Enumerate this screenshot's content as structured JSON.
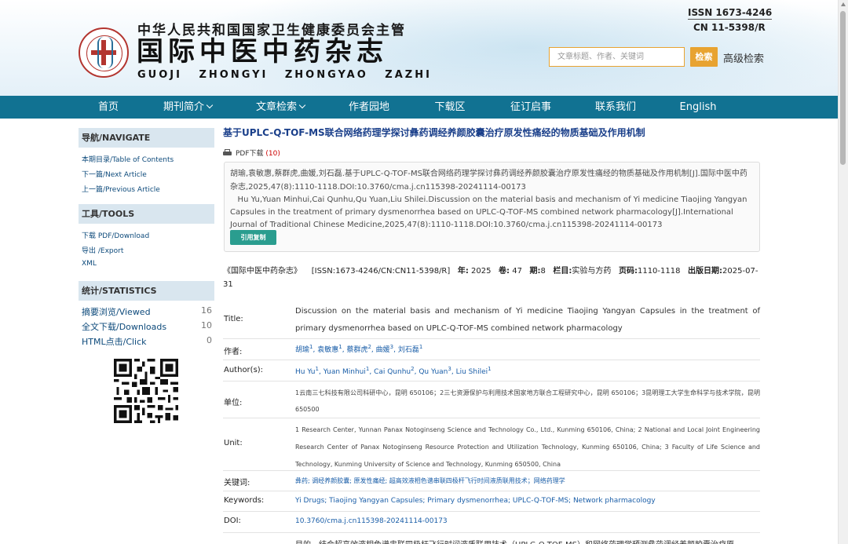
{
  "header": {
    "sponsor": "中华人民共和国国家卫生健康委员会主管",
    "journal_cn": "国际中医中药杂志",
    "journal_pinyin": "GUOJI ZHONGYI ZHONGYAO ZAZHI",
    "issn": "ISSN 1673-4246",
    "cn": "CN 11-5398/R",
    "search_placeholder": "文章标题、作者、关键词",
    "search_button": "检索",
    "advanced_search": "高级检索"
  },
  "nav": [
    {
      "label": "首页",
      "dropdown": false
    },
    {
      "label": "期刊简介",
      "dropdown": true
    },
    {
      "label": "文章检索",
      "dropdown": true
    },
    {
      "label": "作者园地",
      "dropdown": false
    },
    {
      "label": "下载区",
      "dropdown": false
    },
    {
      "label": "征订启事",
      "dropdown": false
    },
    {
      "label": "联系我们",
      "dropdown": false
    },
    {
      "label": "English",
      "dropdown": false
    }
  ],
  "sidebar": {
    "navigate_title": "导航/NAVIGATE",
    "navigate_links": [
      "本期目录/Table of Contents",
      "下一篇/Next Article",
      "上一篇/Previous Article"
    ],
    "tools_title": "工具/TOOLS",
    "tools_links": [
      "下载 PDF/Download",
      "导出 /Export",
      "XML"
    ],
    "stats_title": "统计/STATISTICS",
    "stats": [
      {
        "label": "摘要浏览/Viewed",
        "value": "16"
      },
      {
        "label": "全文下载/Downloads",
        "value": "10"
      },
      {
        "label": "HTML点击/Click",
        "value": "0"
      }
    ]
  },
  "article": {
    "title": "基于UPLC-Q-TOF-MS联合网络药理学探讨彝药调经养颜胶囊治疗原发性痛经的物质基础及作用机制",
    "pdf_label": "PDF下载",
    "pdf_count": "(10)",
    "citation_cn": "胡瑜,袁敏惠,蔡群虎,曲媛,刘石磊.基于UPLC-Q-TOF-MS联合网络药理学探讨彝药调经养颜胶囊治疗原发性痛经的物质基础及作用机制[J].国际中医中药杂志,2025,47(8):1110-1118.DOI:10.3760/cma.j.cn115398-20241114-00173",
    "citation_en": "Hu Yu,Yuan Minhui,Cai Qunhu,Qu Yuan,Liu Shilei.Discussion on the material basis and mechanism of Yi medicine Tiaojing Yangyan Capsules in the treatment of primary dysmenorrhea based on UPLC-Q-TOF-MS combined network pharmacology[J].International Journal of Traditional Chinese Medicine,2025,47(8):1110-1118.DOI:10.3760/cma.j.cn115398-20241114-00173",
    "cite_button": "引用复制",
    "meta": {
      "journal": "《国际中医中药杂志》",
      "issn": "[ISSN:1673-4246/CN:CN11-5398/R]",
      "year_label": "年:",
      "year": "2025",
      "volume_label": "卷:",
      "volume": "47",
      "issue_label": "期:",
      "issue": "8",
      "column_label": "栏目:",
      "column": "实验与方药",
      "pages_label": "页码:",
      "pages": "1110-1118",
      "date_label": "出版日期:",
      "date": "2025-07-31"
    },
    "rows": {
      "title_label": "Title:",
      "title_en": "Discussion on the material basis and mechanism of Yi medicine Tiaojing Yangyan Capsules in the treatment of primary dysmenorrhea based on UPLC-Q-TOF-MS combined network pharmacology",
      "authors_cn_label": "作者:",
      "authors_cn": [
        {
          "name": "胡瑜",
          "sup": "1",
          "sep": ", "
        },
        {
          "name": "袁敏惠",
          "sup": "1",
          "sep": ", "
        },
        {
          "name": "蔡群虎",
          "sup": "2",
          "sep": ", "
        },
        {
          "name": "曲媛",
          "sup": "3",
          "sep": ", "
        },
        {
          "name": "刘石磊",
          "sup": "1",
          "sep": ""
        }
      ],
      "authors_en_label": "Author(s):",
      "authors_en": [
        {
          "name": "Hu Yu",
          "sup": "1",
          "sep": ", "
        },
        {
          "name": "Yuan Minhui",
          "sup": "1",
          "sep": ", "
        },
        {
          "name": "Cai Qunhu",
          "sup": "2",
          "sep": ", "
        },
        {
          "name": "Qu Yuan",
          "sup": "3",
          "sep": ", "
        },
        {
          "name": "Liu Shilei",
          "sup": "1",
          "sep": ""
        }
      ],
      "unit_cn_label": "单位:",
      "unit_cn": "1云南三七科技有限公司科研中心，昆明 650106；2三七资源保护与利用技术国家地方联合工程研究中心，昆明 650106；3昆明理工大学生命科学与技术学院，昆明 650500",
      "unit_en_label": "Unit:",
      "unit_en": "1 Research Center, Yunnan Panax Notoginseng Science and Technology Co., Ltd., Kunming 650106, China; 2 National and Local Joint Engineering Research Center of Panax Notoginseng Resource Protection and Utilization Technology, Kunming 650106, China; 3 Faculty of Life Science and Technology, Kunming University of Science and Technology, Kunming 650500, China",
      "keywords_cn_label": "关键词:",
      "keywords_cn": "彝药; 调经养颜胶囊; 原发性痛经; 超高效液相色谱串联四极杆飞行时间液质联用技术；网络药理学",
      "keywords_en_label": "Keywords:",
      "keywords_en": "Yi Drugs; Tiaojing Yangyan Capsules; Primary dysmenorrhea; UPLC-Q-TOF-MS; Network pharmacology",
      "doi_label": "DOI:",
      "doi": "10.3760/cma.j.cn115398-20241114-00173",
      "abstract_partial": "目的　结合超高效液相色谱串联四极杆飞行时间液质联用技术（UPLC-Q-TOF-MS）和网络药理学预测彝药调经养颜胶囊治疗原"
    }
  }
}
